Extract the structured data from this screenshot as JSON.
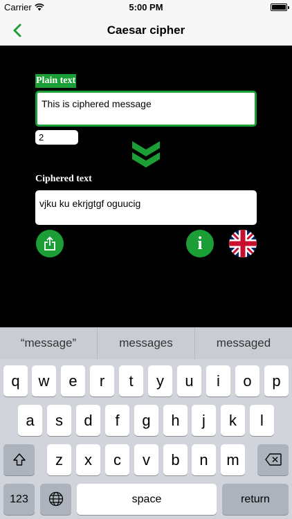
{
  "status_bar": {
    "carrier": "Carrier",
    "time": "5:00 PM"
  },
  "nav": {
    "title": "Caesar cipher"
  },
  "form": {
    "plain_label": "Plain text",
    "plain_value": "This is ciphered message",
    "shift_value": "2",
    "ciphered_label": "Ciphered text",
    "ciphered_value": "vjku ku ekrjgtgf oguucig"
  },
  "colors": {
    "accent": "#1a9e35",
    "background": "#000000"
  },
  "icons": {
    "share": "share-icon",
    "info": "info-icon",
    "language": "uk-flag-icon",
    "arrows": "double-chevron-down-icon"
  },
  "info_glyph": "i",
  "keyboard": {
    "predictions": [
      "“message”",
      "messages",
      "messaged"
    ],
    "row1": [
      "q",
      "w",
      "e",
      "r",
      "t",
      "y",
      "u",
      "i",
      "o",
      "p"
    ],
    "row2": [
      "a",
      "s",
      "d",
      "f",
      "g",
      "h",
      "j",
      "k",
      "l"
    ],
    "row3": [
      "z",
      "x",
      "c",
      "v",
      "b",
      "n",
      "m"
    ],
    "numbers_label": "123",
    "space_label": "space",
    "return_label": "return"
  }
}
